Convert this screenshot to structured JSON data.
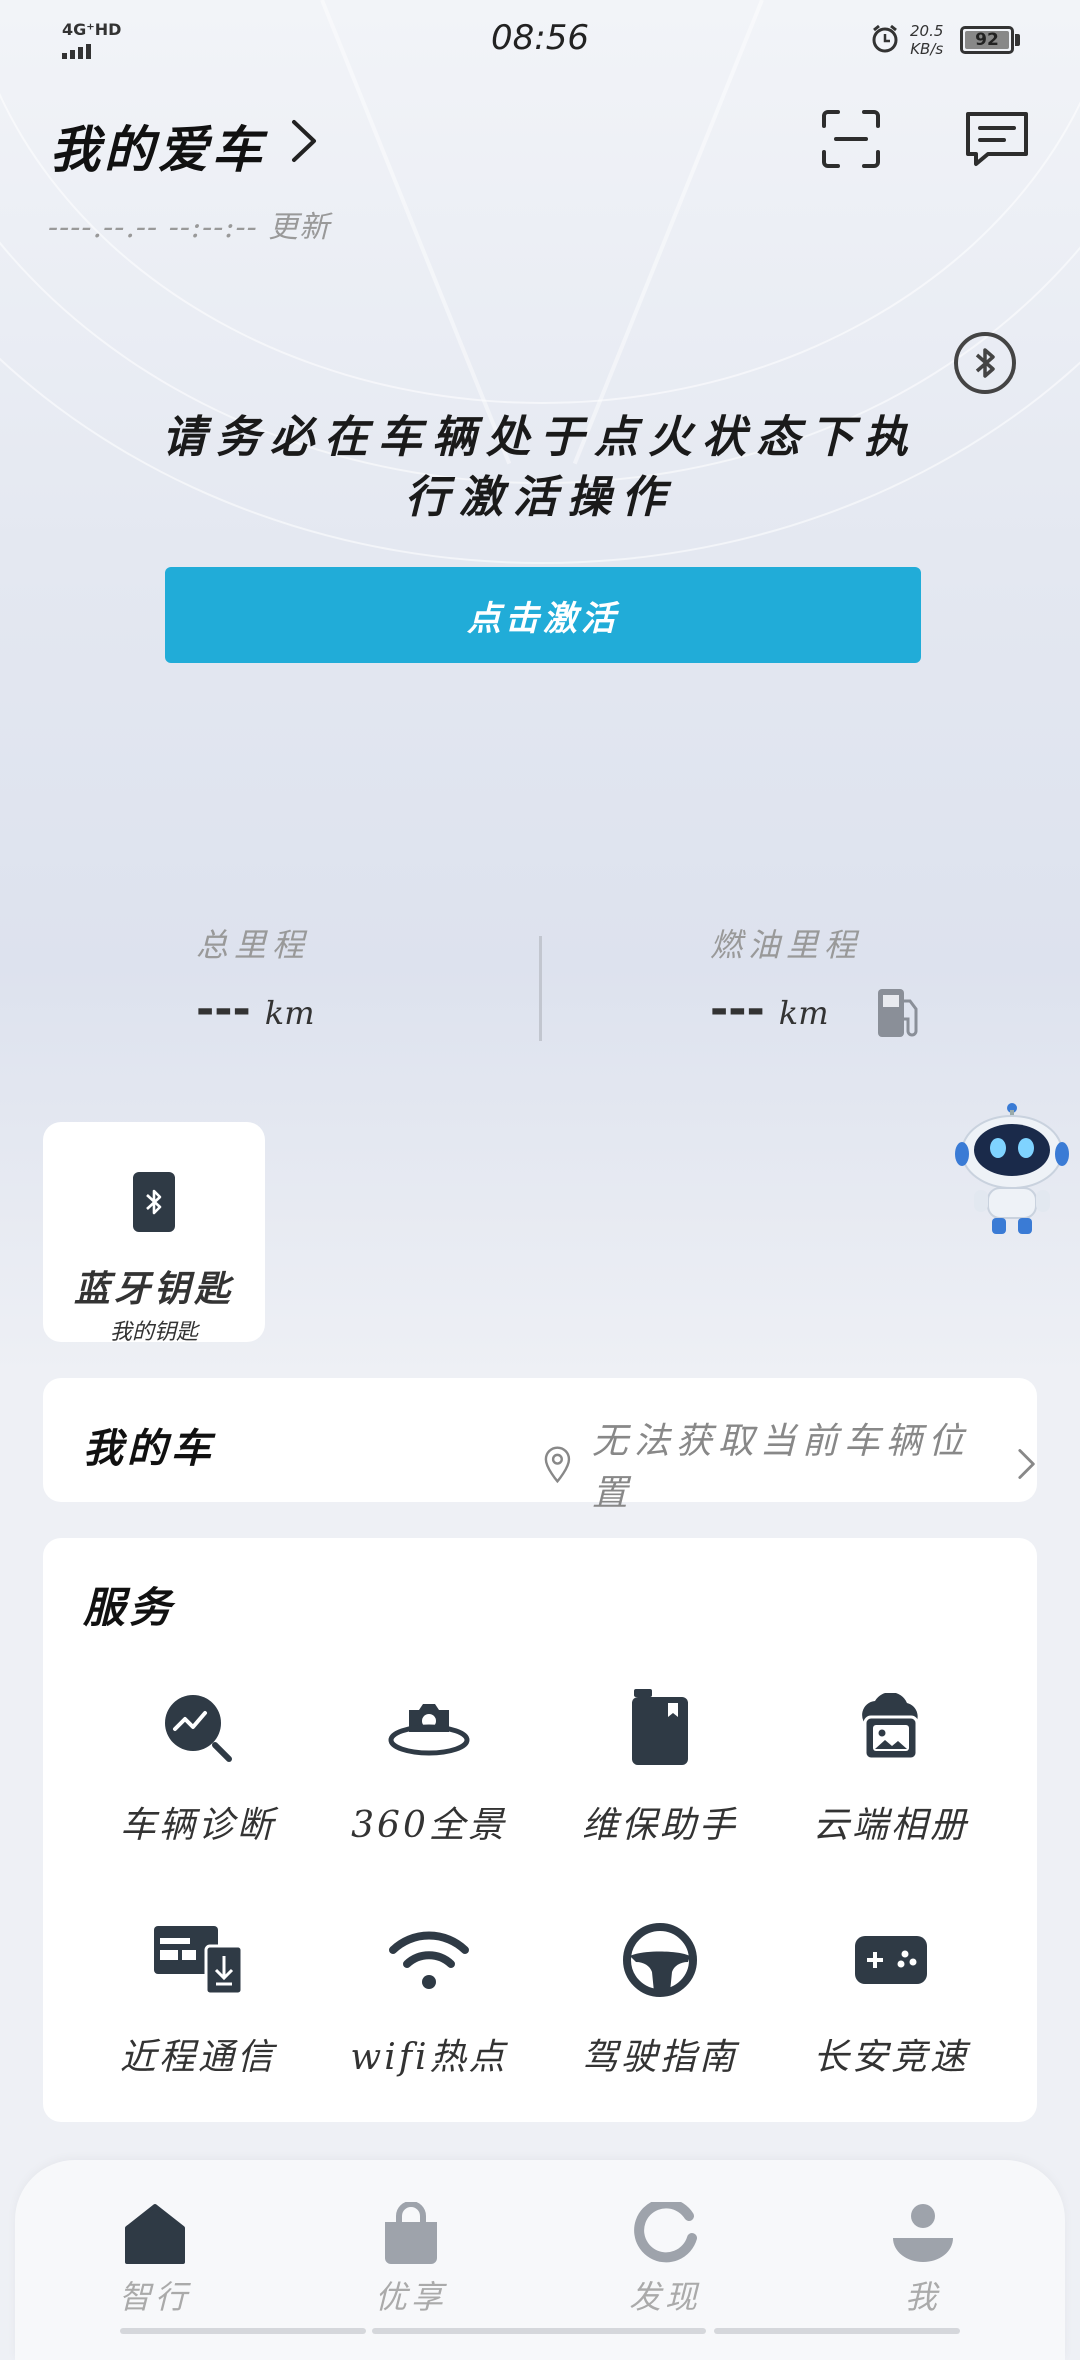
{
  "status_bar": {
    "network": "4G⁺HD",
    "time": "08:56",
    "speed_value": "20.5",
    "speed_unit": "KB/s",
    "battery": "92"
  },
  "header": {
    "title": "我的爱车",
    "updated": "----.--.-- --:--:-- 更新",
    "scan_icon": "scan-icon",
    "message_icon": "message-icon"
  },
  "notice": {
    "text": "请务必在车辆处于点火状态下执行激活操作",
    "activate_label": "点击激活"
  },
  "mileage": {
    "total_label": "总里程",
    "total_value": "---",
    "total_unit": "km",
    "fuel_label": "燃油里程",
    "fuel_value": "---",
    "fuel_unit": "km"
  },
  "bt_key": {
    "title": "蓝牙钥匙",
    "subtitle": "我的钥匙"
  },
  "my_car": {
    "title": "我的车",
    "location": "无法获取当前车辆位置"
  },
  "services": {
    "title": "服务",
    "items": [
      {
        "label": "车辆诊断",
        "icon": "diagnosis-icon"
      },
      {
        "label": "360全景",
        "icon": "camera-360-icon"
      },
      {
        "label": "维保助手",
        "icon": "maintenance-icon"
      },
      {
        "label": "云端相册",
        "icon": "cloud-album-icon"
      },
      {
        "label": "近程通信",
        "icon": "nfc-card-icon"
      },
      {
        "label": "wifi热点",
        "icon": "wifi-icon"
      },
      {
        "label": "驾驶指南",
        "icon": "steering-wheel-icon"
      },
      {
        "label": "长安竞速",
        "icon": "gamepad-icon"
      }
    ]
  },
  "nav": {
    "items": [
      {
        "label": "智行",
        "icon": "home-icon"
      },
      {
        "label": "优享",
        "icon": "bag-icon"
      },
      {
        "label": "发现",
        "icon": "discover-icon"
      },
      {
        "label": "我",
        "icon": "user-icon"
      }
    ]
  },
  "colors": {
    "accent": "#21acd8",
    "icon_dark": "#2f3a45"
  }
}
